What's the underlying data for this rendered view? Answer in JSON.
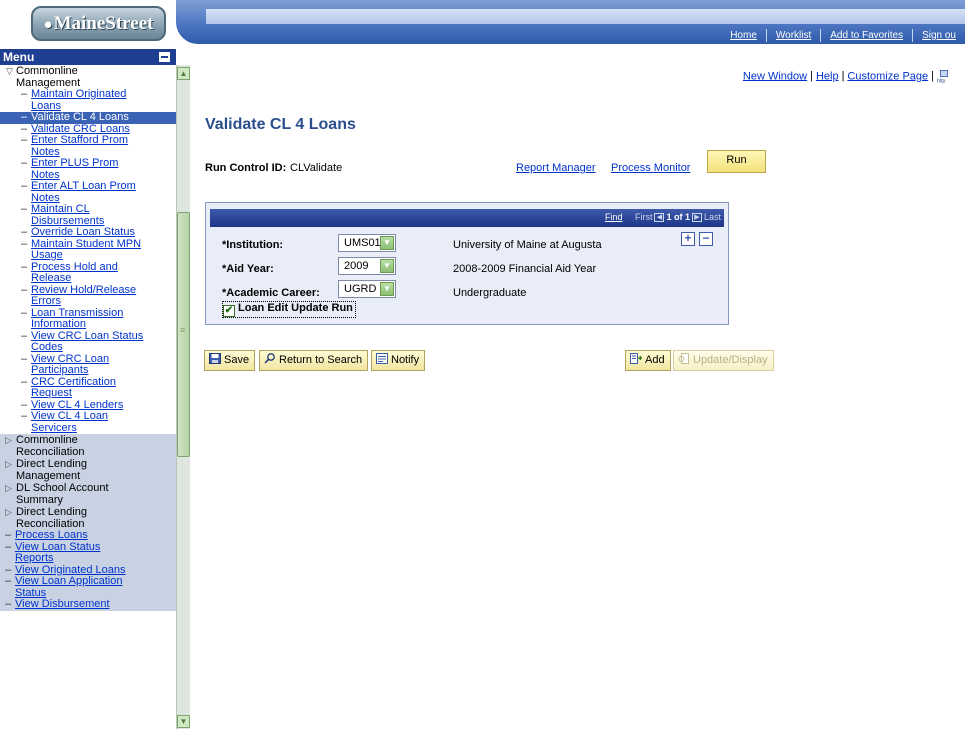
{
  "header": {
    "logo_text": "MaineStreet",
    "top_links": [
      "Home",
      "Worklist",
      "Add to Favorites",
      "Sign ou"
    ]
  },
  "menu": {
    "title": "Menu",
    "open_folder": [
      "Commonline",
      "Management"
    ],
    "items": [
      {
        "lines": [
          "Maintain Originated",
          "Loans"
        ]
      },
      {
        "lines": [
          "Validate CL 4 Loans"
        ],
        "selected": true
      },
      {
        "lines": [
          "Validate CRC Loans"
        ]
      },
      {
        "lines": [
          "Enter Stafford Prom",
          "Notes"
        ]
      },
      {
        "lines": [
          "Enter PLUS Prom",
          "Notes"
        ]
      },
      {
        "lines": [
          "Enter ALT Loan Prom",
          "Notes"
        ]
      },
      {
        "lines": [
          "Maintain CL",
          "Disbursements"
        ]
      },
      {
        "lines": [
          "Override Loan Status"
        ]
      },
      {
        "lines": [
          "Maintain Student MPN",
          "Usage"
        ]
      },
      {
        "lines": [
          "Process Hold and",
          "Release"
        ]
      },
      {
        "lines": [
          "Review Hold/Release",
          "Errors"
        ]
      },
      {
        "lines": [
          "Loan Transmission",
          "Information"
        ]
      },
      {
        "lines": [
          "View CRC Loan Status",
          "Codes"
        ]
      },
      {
        "lines": [
          "View CRC Loan",
          "Participants"
        ]
      },
      {
        "lines": [
          "CRC Certification",
          "Request"
        ]
      },
      {
        "lines": [
          "View CL 4 Lenders"
        ]
      },
      {
        "lines": [
          "View CL 4 Loan",
          "Servicers"
        ]
      }
    ],
    "closed_folders": [
      [
        "Commonline",
        "Reconciliation"
      ],
      [
        "Direct Lending",
        "Management"
      ],
      [
        "DL School Account",
        "Summary"
      ],
      [
        "Direct Lending",
        "Reconciliation"
      ]
    ],
    "lower_items": [
      [
        "Process Loans"
      ],
      [
        "View Loan Status",
        "Reports"
      ],
      [
        "View Originated Loans"
      ],
      [
        "View Loan Application",
        "Status"
      ],
      [
        "View Disbursement"
      ]
    ]
  },
  "page_links": {
    "new_window": "New Window",
    "help": "Help",
    "customize": "Customize Page",
    "sep": "|"
  },
  "page": {
    "title": "Validate CL 4 Loans",
    "run_control_label": "Run Control ID:",
    "run_control_value": "CLValidate",
    "report_manager": "Report Manager",
    "process_monitor": "Process Monitor",
    "run_label": "Run"
  },
  "criteria": {
    "find": "Find",
    "first": "First",
    "count": "1 of 1",
    "last": "Last",
    "fields": [
      {
        "label": "*Institution:",
        "value": "UMS01",
        "description": "University of Maine at Augusta"
      },
      {
        "label": "*Aid Year:",
        "value": "2009",
        "description": "2008-2009 Financial Aid Year"
      },
      {
        "label": "*Academic Career:",
        "value": "UGRD",
        "description": "Undergraduate"
      }
    ],
    "checkbox_label": "Loan Edit Update Run",
    "checkbox_checked": true
  },
  "toolbar": {
    "save": "Save",
    "return_to_search": "Return to Search",
    "notify": "Notify",
    "add": "Add",
    "update_display": "Update/Display"
  },
  "colors": {
    "header_blue": "#2f5aaa",
    "menu_header": "#1f3f93",
    "selected_item": "#3a62b5",
    "title_blue": "#2b4e8c",
    "button_yellow": "#f3e27b"
  }
}
